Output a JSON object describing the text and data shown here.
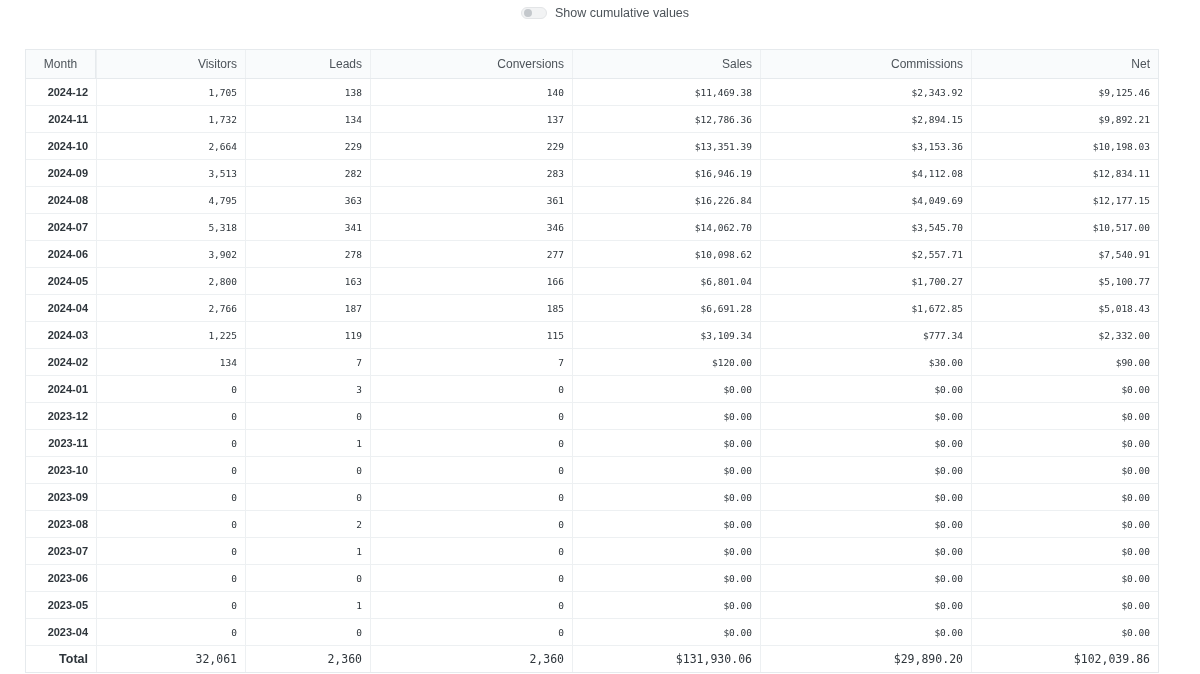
{
  "toggle": {
    "label": "Show cumulative values",
    "on": false
  },
  "table": {
    "columns": [
      "Month",
      "Visitors",
      "Leads",
      "Conversions",
      "Sales",
      "Commissions",
      "Net"
    ],
    "rows": [
      [
        "2024-12",
        "1,705",
        "138",
        "140",
        "$11,469.38",
        "$2,343.92",
        "$9,125.46"
      ],
      [
        "2024-11",
        "1,732",
        "134",
        "137",
        "$12,786.36",
        "$2,894.15",
        "$9,892.21"
      ],
      [
        "2024-10",
        "2,664",
        "229",
        "229",
        "$13,351.39",
        "$3,153.36",
        "$10,198.03"
      ],
      [
        "2024-09",
        "3,513",
        "282",
        "283",
        "$16,946.19",
        "$4,112.08",
        "$12,834.11"
      ],
      [
        "2024-08",
        "4,795",
        "363",
        "361",
        "$16,226.84",
        "$4,049.69",
        "$12,177.15"
      ],
      [
        "2024-07",
        "5,318",
        "341",
        "346",
        "$14,062.70",
        "$3,545.70",
        "$10,517.00"
      ],
      [
        "2024-06",
        "3,902",
        "278",
        "277",
        "$10,098.62",
        "$2,557.71",
        "$7,540.91"
      ],
      [
        "2024-05",
        "2,800",
        "163",
        "166",
        "$6,801.04",
        "$1,700.27",
        "$5,100.77"
      ],
      [
        "2024-04",
        "2,766",
        "187",
        "185",
        "$6,691.28",
        "$1,672.85",
        "$5,018.43"
      ],
      [
        "2024-03",
        "1,225",
        "119",
        "115",
        "$3,109.34",
        "$777.34",
        "$2,332.00"
      ],
      [
        "2024-02",
        "134",
        "7",
        "7",
        "$120.00",
        "$30.00",
        "$90.00"
      ],
      [
        "2024-01",
        "0",
        "3",
        "0",
        "$0.00",
        "$0.00",
        "$0.00"
      ],
      [
        "2023-12",
        "0",
        "0",
        "0",
        "$0.00",
        "$0.00",
        "$0.00"
      ],
      [
        "2023-11",
        "0",
        "1",
        "0",
        "$0.00",
        "$0.00",
        "$0.00"
      ],
      [
        "2023-10",
        "0",
        "0",
        "0",
        "$0.00",
        "$0.00",
        "$0.00"
      ],
      [
        "2023-09",
        "0",
        "0",
        "0",
        "$0.00",
        "$0.00",
        "$0.00"
      ],
      [
        "2023-08",
        "0",
        "2",
        "0",
        "$0.00",
        "$0.00",
        "$0.00"
      ],
      [
        "2023-07",
        "0",
        "1",
        "0",
        "$0.00",
        "$0.00",
        "$0.00"
      ],
      [
        "2023-06",
        "0",
        "0",
        "0",
        "$0.00",
        "$0.00",
        "$0.00"
      ],
      [
        "2023-05",
        "0",
        "1",
        "0",
        "$0.00",
        "$0.00",
        "$0.00"
      ],
      [
        "2023-04",
        "0",
        "0",
        "0",
        "$0.00",
        "$0.00",
        "$0.00"
      ]
    ],
    "total": [
      "Total",
      "32,061",
      "2,360",
      "2,360",
      "$131,930.06",
      "$29,890.20",
      "$102,039.86"
    ]
  }
}
